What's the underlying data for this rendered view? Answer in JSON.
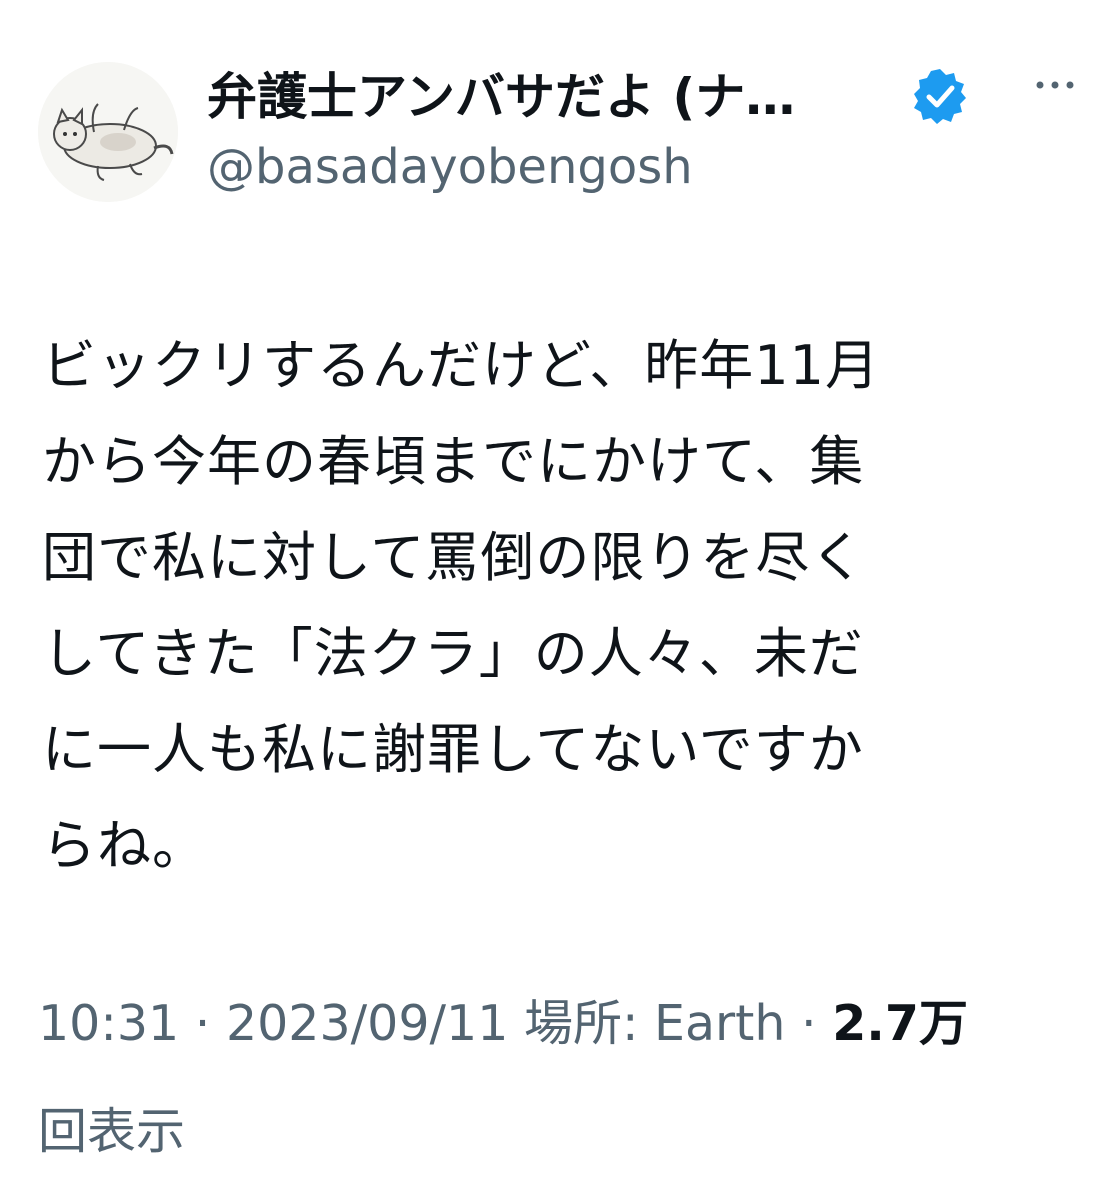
{
  "author": {
    "display_name": "弁護士アンバサだよ (ナ…",
    "handle": "@basadayobengosh",
    "avatar_icon": "cat-avatar-icon",
    "verified_icon": "verified-badge-icon"
  },
  "more_icon": "more-options-icon",
  "tweet": {
    "lines": [
      "ビックリするんだけど、昨年11月",
      "から今年の春頃までにかけて、集",
      "団で私に対して罵倒の限りを尽く",
      "してきた「法クラ」の人々、未だ",
      "に一人も私に謝罪してないですか",
      "らね。"
    ]
  },
  "meta": {
    "time": "10:31",
    "separator1": " · ",
    "date": "2023/09/11",
    "location_label": "場所: Earth",
    "separator2": " · ",
    "views_count": "2.7万",
    "views_label": "回表示"
  },
  "colors": {
    "text": "#0f1419",
    "secondary": "#536471",
    "verified": "#1d9bf0"
  }
}
